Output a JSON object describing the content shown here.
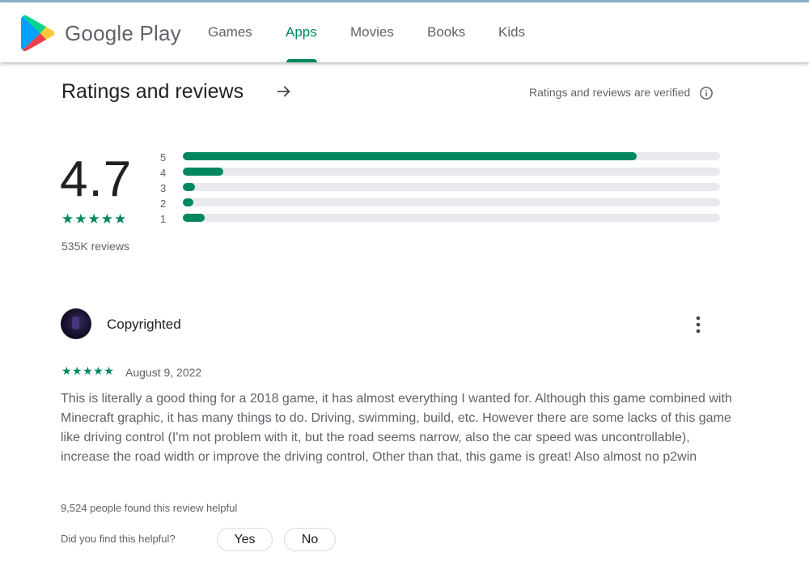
{
  "header": {
    "brand": "Google Play",
    "nav": [
      {
        "label": "Games",
        "active": false
      },
      {
        "label": "Apps",
        "active": true
      },
      {
        "label": "Movies",
        "active": false
      },
      {
        "label": "Books",
        "active": false
      },
      {
        "label": "Kids",
        "active": false
      }
    ]
  },
  "ratings": {
    "title": "Ratings and reviews",
    "verified_text": "Ratings and reviews are verified",
    "score": "4.7",
    "stars": "★★★★★",
    "review_count": "535K reviews",
    "distribution": [
      {
        "label": "5",
        "fraction": 0.845
      },
      {
        "label": "4",
        "fraction": 0.075
      },
      {
        "label": "3",
        "fraction": 0.022
      },
      {
        "label": "2",
        "fraction": 0.016
      },
      {
        "label": "1",
        "fraction": 0.04
      }
    ]
  },
  "review": {
    "author": "Copyrighted",
    "stars": "★★★★★",
    "date": "August 9, 2022",
    "text": "This is literally a good thing for a 2018 game, it has almost everything I wanted for. Although this game combined with Minecraft graphic, it has many things to do. Driving, swimming, build, etc. However there are some lacks of this game like driving control (I'm not problem with it, but the road seems narrow, also the car speed was uncontrollable), increase the road width or improve the driving control, Other than that, this game is great! Also almost no p2win",
    "helpful_count": "9,524 people found this review helpful",
    "helpful_question": "Did you find this helpful?",
    "yes_label": "Yes",
    "no_label": "No"
  },
  "colors": {
    "accent": "#01875f",
    "track": "#e8eaed",
    "muted_text": "#5f6368"
  },
  "icons": {
    "logo": "google-play-logo",
    "arrow": "arrow-right-icon",
    "info": "info-icon",
    "more": "more-vert-icon"
  }
}
